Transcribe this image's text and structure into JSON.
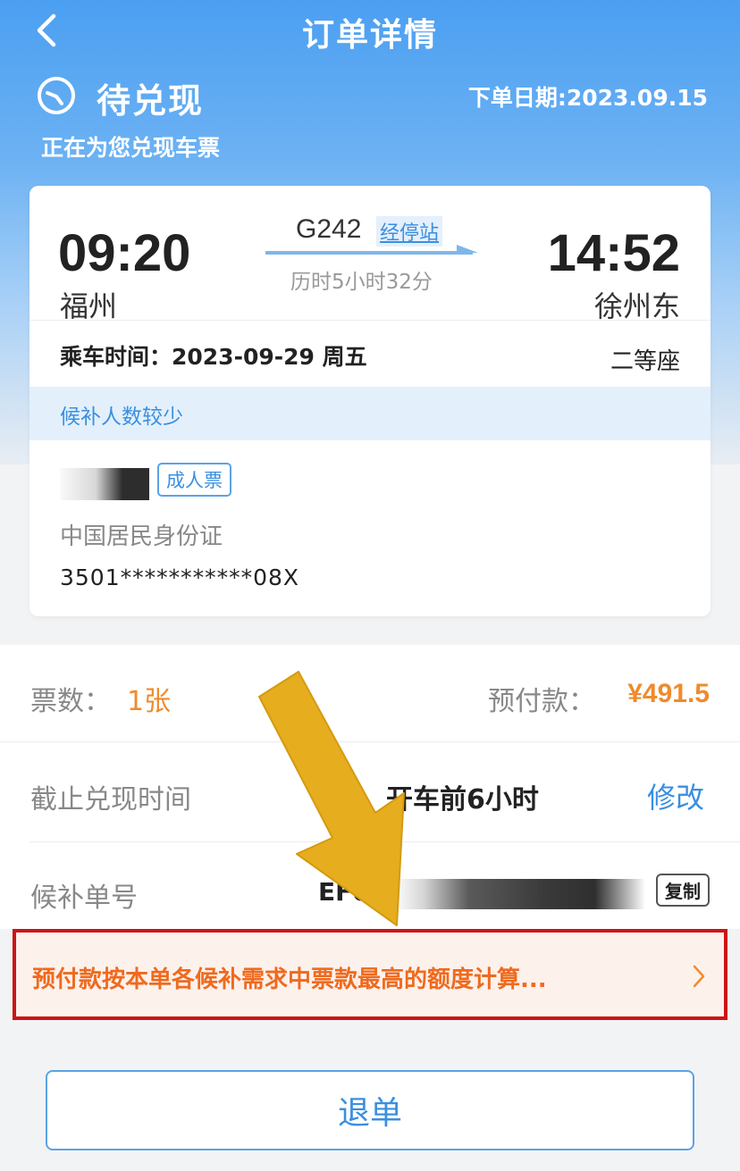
{
  "nav": {
    "title": "订单详情"
  },
  "status": {
    "title": "待兑现",
    "order_date": "下单日期:2023.09.15",
    "desc": "正在为您兑现车票"
  },
  "trip": {
    "dep_time": "09:20",
    "dep_station": "福州",
    "arr_time": "14:52",
    "arr_station": "徐州东",
    "train_no": "G242",
    "stops_link": "经停站",
    "duration": "历时5小时32分",
    "ride_time": "乘车时间：2023-09-29 周五",
    "seat_class": "二等座",
    "waitlist_note": "候补人数较少"
  },
  "passenger": {
    "ticket_type": "成人票",
    "id_type": "中国居民身份证",
    "id_number": "3501***********08X"
  },
  "info": {
    "qty_label": "票数：",
    "qty_value": "1张",
    "prepay_label": "预付款：",
    "prepay_value": "¥491.5",
    "deadline_label": "截止兑现时间",
    "deadline_value": "开车前6小时",
    "modify_label": "修改",
    "waitlist_label": "候补单号",
    "waitlist_no": "EF0",
    "copy_label": "复制"
  },
  "notice": {
    "text": "预付款按本单各候补需求中票款最高的额度计算..."
  },
  "actions": {
    "refund_label": "退单"
  },
  "colors": {
    "brand_blue": "#3a8fe0",
    "accent_orange": "#ef8b2c",
    "highlight_red": "#cc1414",
    "arrow_yellow": "#e6ad1e"
  }
}
